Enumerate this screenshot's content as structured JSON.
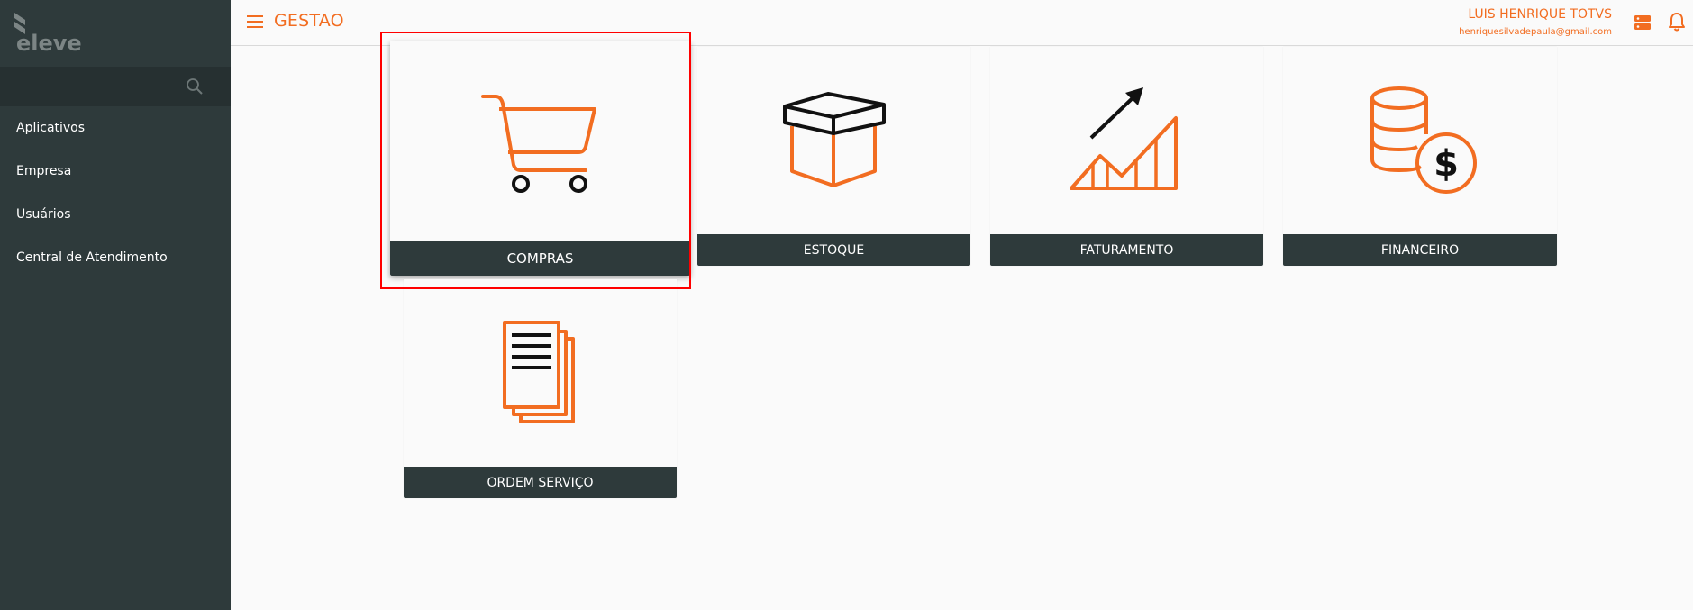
{
  "sidebar": {
    "logo_icon": "eleve-logo",
    "search": {
      "icon": "search-icon",
      "value": ""
    },
    "items": [
      {
        "label": "Aplicativos"
      },
      {
        "label": "Empresa"
      },
      {
        "label": "Usuários"
      },
      {
        "label": "Central de Atendimento"
      }
    ]
  },
  "header": {
    "menu_icon": "hamburger-icon",
    "title": "GESTAO",
    "user_name": "LUIS HENRIQUE TOTVS",
    "user_email": "henriquesilvadepaula@gmail.com",
    "icons": [
      "server-icon",
      "bell-icon"
    ]
  },
  "tiles": [
    {
      "label": "COMPRAS",
      "icon": "shopping-cart-icon",
      "highlighted": true
    },
    {
      "label": "ESTOQUE",
      "icon": "box-icon",
      "highlighted": false
    },
    {
      "label": "FATURAMENTO",
      "icon": "growth-chart-icon",
      "highlighted": false
    },
    {
      "label": "FINANCEIRO",
      "icon": "coins-dollar-icon",
      "highlighted": false
    },
    {
      "label": "ORDEM SERVIÇO",
      "icon": "documents-icon",
      "highlighted": false
    }
  ],
  "colors": {
    "accent": "#f26d21",
    "sidebar_bg": "#2e3a3b",
    "search_bg": "#263031",
    "page_bg": "#fafafa",
    "highlight": "#ff0000"
  }
}
